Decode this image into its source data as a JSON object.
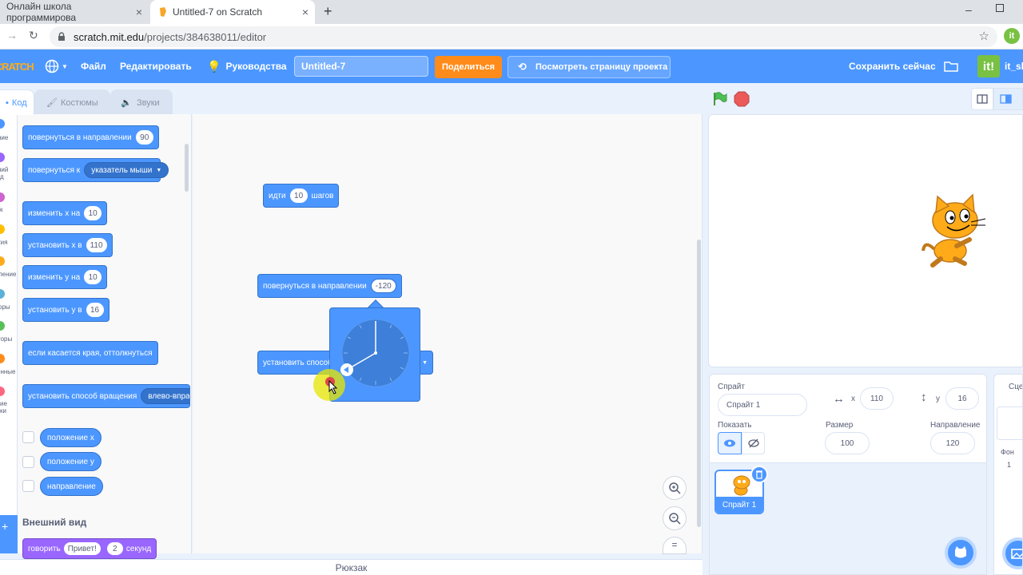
{
  "browser": {
    "tabs": [
      {
        "title": "Онлайн школа программирова"
      },
      {
        "title": "Untitled-7 on Scratch"
      }
    ],
    "url_host": "scratch.mit.edu",
    "url_path": "/projects/384638011/editor"
  },
  "menu": {
    "logo": "SCRATCH",
    "file": "Файл",
    "edit": "Редактировать",
    "tutorials": "Руководства",
    "project_title": "Untitled-7",
    "share": "Поделиться",
    "see_project": "Посмотреть страницу проекта",
    "save_now": "Сохранить сейчас",
    "user": "it_sk"
  },
  "tabs": {
    "code": "Код",
    "costumes": "Костюмы",
    "sounds": "Звуки"
  },
  "categories": [
    {
      "label": "ние",
      "color": "#4c97ff"
    },
    {
      "label": "ний",
      "label2": "д",
      "color": "#9966ff"
    },
    {
      "label": "к",
      "color": "#cf63cf"
    },
    {
      "label": "тия",
      "color": "#ffbf00"
    },
    {
      "label": "ление",
      "color": "#ffab19"
    },
    {
      "label": "оры",
      "color": "#5cb1d6"
    },
    {
      "label": "торы",
      "color": "#59c059"
    },
    {
      "label": "енные",
      "color": "#ff8c1a"
    },
    {
      "label": "ие",
      "label2": "ки",
      "color": "#ff6680"
    }
  ],
  "palette": {
    "turn_dir": "повернуться в направлении",
    "turn_dir_val": "90",
    "point_towards": "повернуться к",
    "point_towards_val": "указатель мыши",
    "change_x": "изменить х на",
    "change_x_val": "10",
    "set_x": "установить х в",
    "set_x_val": "110",
    "change_y": "изменить у на",
    "change_y_val": "10",
    "set_y": "установить у в",
    "set_y_val": "16",
    "bounce": "если касается края, оттолкнуться",
    "rot_style": "установить способ вращения",
    "rot_style_val": "влево-вправо",
    "rep_x": "положение х",
    "rep_y": "положение у",
    "rep_dir": "направление",
    "looks_header": "Внешний вид",
    "say": "говорить",
    "say_text": "Привет!",
    "say_secs": "2",
    "say_unit": "секунд"
  },
  "workspace": {
    "move_label": "идти",
    "move_val": "10",
    "move_unit": "шагов",
    "turn_label": "повернуться в направлении",
    "turn_val": "-120",
    "rot_label": "установить способ"
  },
  "backpack": "Рюкзак",
  "sprite": {
    "label": "Спрайт",
    "name": "Спрайт 1",
    "x_label": "x",
    "x": "110",
    "y_label": "y",
    "y": "16",
    "show_label": "Показать",
    "size_label": "Размер",
    "size": "100",
    "dir_label": "Направление",
    "dir": "120",
    "thumb_label": "Спрайт 1"
  },
  "stage_panel": {
    "label": "Сцен",
    "backdrops_label": "Фон",
    "backdrops_count": "1"
  }
}
